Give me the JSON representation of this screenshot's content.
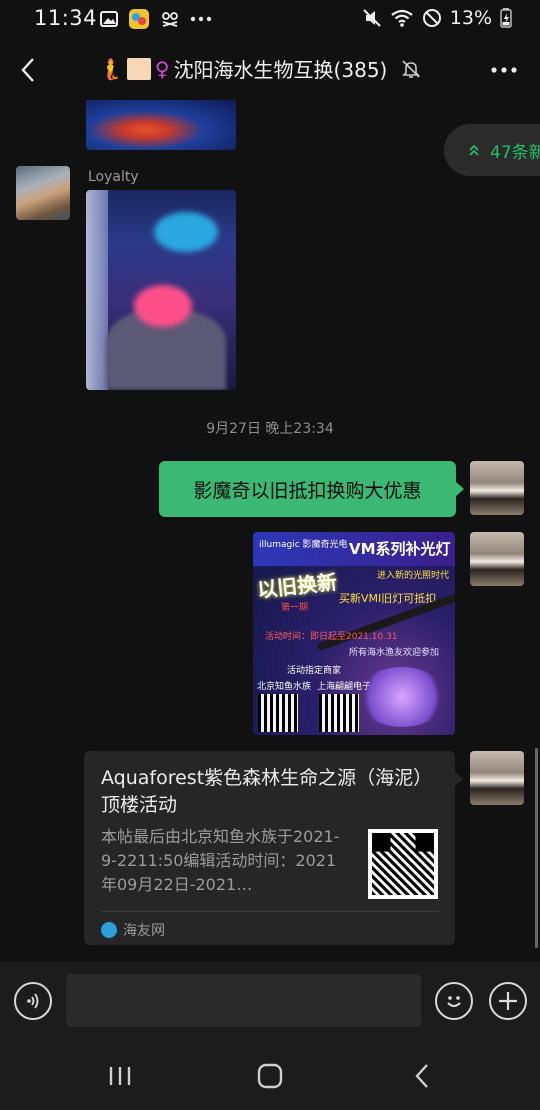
{
  "status_bar": {
    "time": "11:34",
    "battery": "13%",
    "icons_left": [
      "gallery-icon",
      "app-icon",
      "video-off-icon",
      "more-dots-icon"
    ],
    "icons_right": [
      "mute-icon",
      "wifi-icon",
      "dnd-icon",
      "battery-icon"
    ]
  },
  "header": {
    "title_emoji": "🧜",
    "title_symbol": "♀",
    "title_text": "沈阳海水生物互换(385)",
    "mute_icon": "bell-off-icon"
  },
  "new_messages_badge": "47条新",
  "messages": {
    "sender_name": "Loyalty",
    "timestamp": "9月27日 晚上23:34",
    "green_text": "影魔奇以旧抵扣换购大优惠",
    "poster": {
      "brand": "illumagic 影魔奇光电",
      "heading": "VM系列补光灯",
      "tagline": "进入新的光照时代",
      "big": "以旧换新",
      "line2": "买新VMI旧灯可抵扣",
      "red_label": "第一期",
      "mid": "活动时间：即日起至2021.10.31",
      "mid2": "所有海水渔友欢迎参加",
      "w1": "活动指定商家",
      "w2": "北京知鱼水族",
      "w3": "上海翩翩电子"
    },
    "card": {
      "title": "Aquaforest紫色森林生命之源（海泥）顶楼活动",
      "desc": "本帖最后由北京知鱼水族于2021-9-2211:50编辑活动时间：2021年09月22日-2021…",
      "source": "海友网"
    }
  },
  "colors": {
    "green_bubble": "#3bb873",
    "badge_text": "#1fbf66",
    "background": "#111111"
  }
}
